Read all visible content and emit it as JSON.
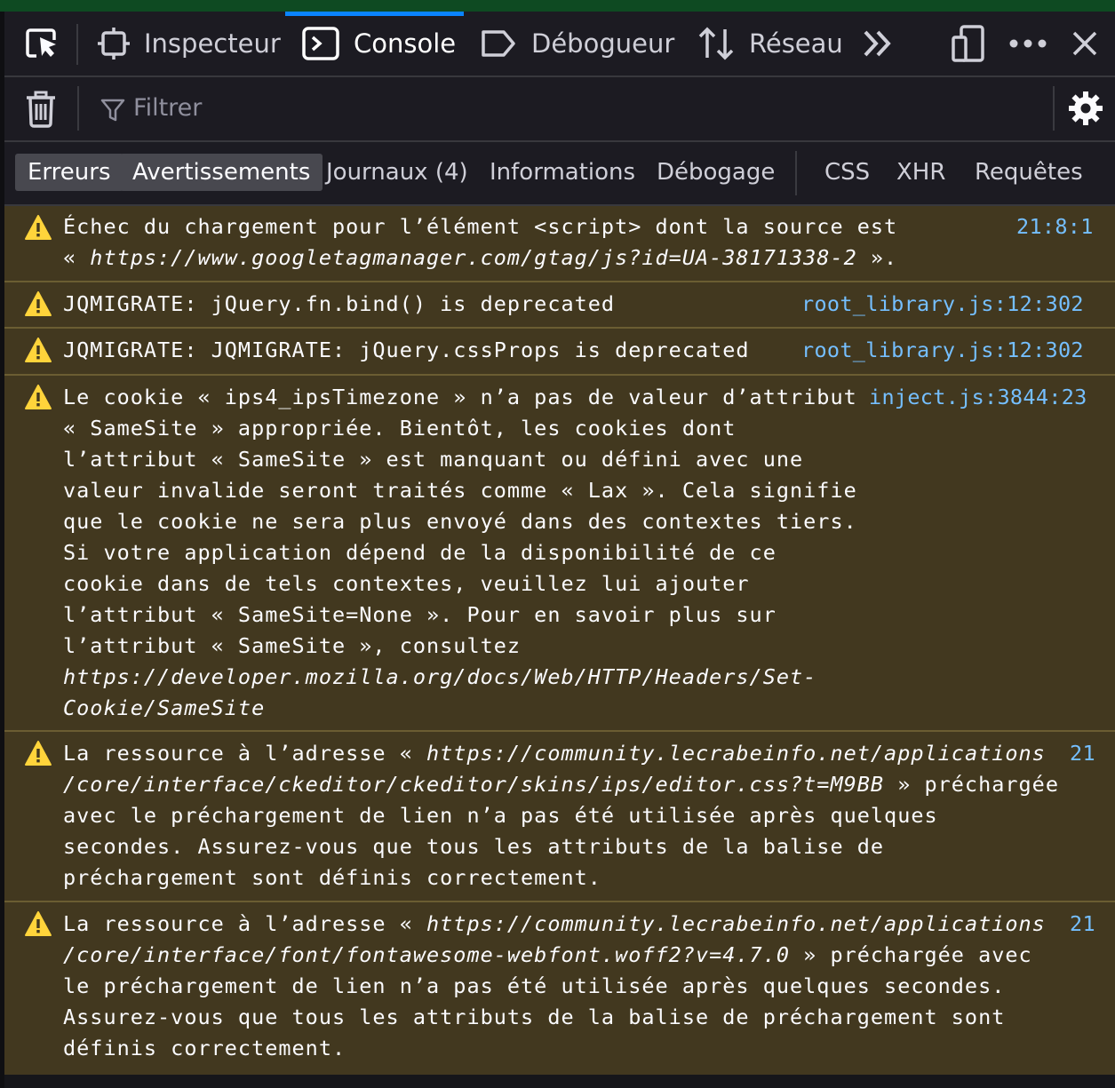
{
  "toolbar": {
    "tabs": [
      {
        "label": "Inspecteur",
        "icon": "inspector-icon"
      },
      {
        "label": "Console",
        "icon": "console-icon",
        "selected": true
      },
      {
        "label": "Débogueur",
        "icon": "debugger-icon"
      },
      {
        "label": "Réseau",
        "icon": "network-icon"
      }
    ],
    "accent_color": "#0a84ff"
  },
  "filter": {
    "placeholder": "Filtrer"
  },
  "levels": {
    "errors": "Erreurs",
    "warnings": "Avertissements",
    "logs": "Journaux (4)",
    "info": "Informations",
    "debug": "Débogage",
    "css": "CSS",
    "xhr": "XHR",
    "requests": "Requêtes"
  },
  "messages": [
    {
      "type": "warning",
      "lines": [
        [
          {
            "t": "Échec du chargement pour l’élément <script> dont la source est"
          }
        ],
        [
          {
            "t": "« "
          },
          {
            "t": "https://www.googletagmanager.com/gtag/js?id=UA-38171338-2",
            "i": true
          },
          {
            "t": " »."
          }
        ]
      ],
      "location": "21:8:1"
    },
    {
      "type": "warning",
      "lines": [
        [
          {
            "t": "JQMIGRATE: jQuery.fn.bind() is deprecated"
          }
        ]
      ],
      "location": "root_library.js:12:302"
    },
    {
      "type": "warning",
      "lines": [
        [
          {
            "t": "JQMIGRATE: JQMIGRATE: jQuery.cssProps is deprecated"
          }
        ]
      ],
      "location": "root_library.js:12:302"
    },
    {
      "type": "warning",
      "lines": [
        [
          {
            "t": "Le cookie « ips4_ipsTimezone » n’a pas de valeur d’attribut"
          }
        ],
        [
          {
            "t": "« SameSite » appropriée. Bientôt, les cookies dont"
          }
        ],
        [
          {
            "t": "l’attribut « SameSite » est manquant ou défini avec une"
          }
        ],
        [
          {
            "t": "valeur invalide seront traités comme « Lax ». Cela signifie"
          }
        ],
        [
          {
            "t": "que le cookie ne sera plus envoyé dans des contextes tiers."
          }
        ],
        [
          {
            "t": "Si votre application dépend de la disponibilité de ce"
          }
        ],
        [
          {
            "t": "cookie dans de tels contextes, veuillez lui ajouter"
          }
        ],
        [
          {
            "t": "l’attribut « SameSite=None ». Pour en savoir plus sur"
          }
        ],
        [
          {
            "t": "l’attribut « SameSite », consultez"
          }
        ],
        [
          {
            "t": "https://developer.mozilla.org/docs/Web/HTTP/Headers/Set-",
            "i": true
          }
        ],
        [
          {
            "t": "Cookie/SameSite",
            "i": true
          }
        ]
      ],
      "location": "inject.js:3844:23"
    },
    {
      "type": "warning",
      "lines": [
        [
          {
            "t": "La ressource à l’adresse « "
          },
          {
            "t": "https://community.lecrabeinfo.net/applications",
            "i": true
          }
        ],
        [
          {
            "t": "/core/interface/ckeditor/ckeditor/skins/ips/editor.css?t=M9BB",
            "i": true
          },
          {
            "t": " » préchargée"
          }
        ],
        [
          {
            "t": "avec le préchargement de lien n’a pas été utilisée après quelques"
          }
        ],
        [
          {
            "t": "secondes. Assurez-vous que tous les attributs de la balise de"
          }
        ],
        [
          {
            "t": "préchargement sont définis correctement."
          }
        ]
      ],
      "location": "21"
    },
    {
      "type": "warning",
      "lines": [
        [
          {
            "t": "La ressource à l’adresse « "
          },
          {
            "t": "https://community.lecrabeinfo.net/applications",
            "i": true
          }
        ],
        [
          {
            "t": "/core/interface/font/fontawesome-webfont.woff2?v=4.7.0",
            "i": true
          },
          {
            "t": " » préchargée avec"
          }
        ],
        [
          {
            "t": "le préchargement de lien n’a pas été utilisée après quelques secondes."
          }
        ],
        [
          {
            "t": "Assurez-vous que tous les attributs de la balise de préchargement sont"
          }
        ],
        [
          {
            "t": "définis correctement."
          }
        ]
      ],
      "location": "21"
    }
  ]
}
